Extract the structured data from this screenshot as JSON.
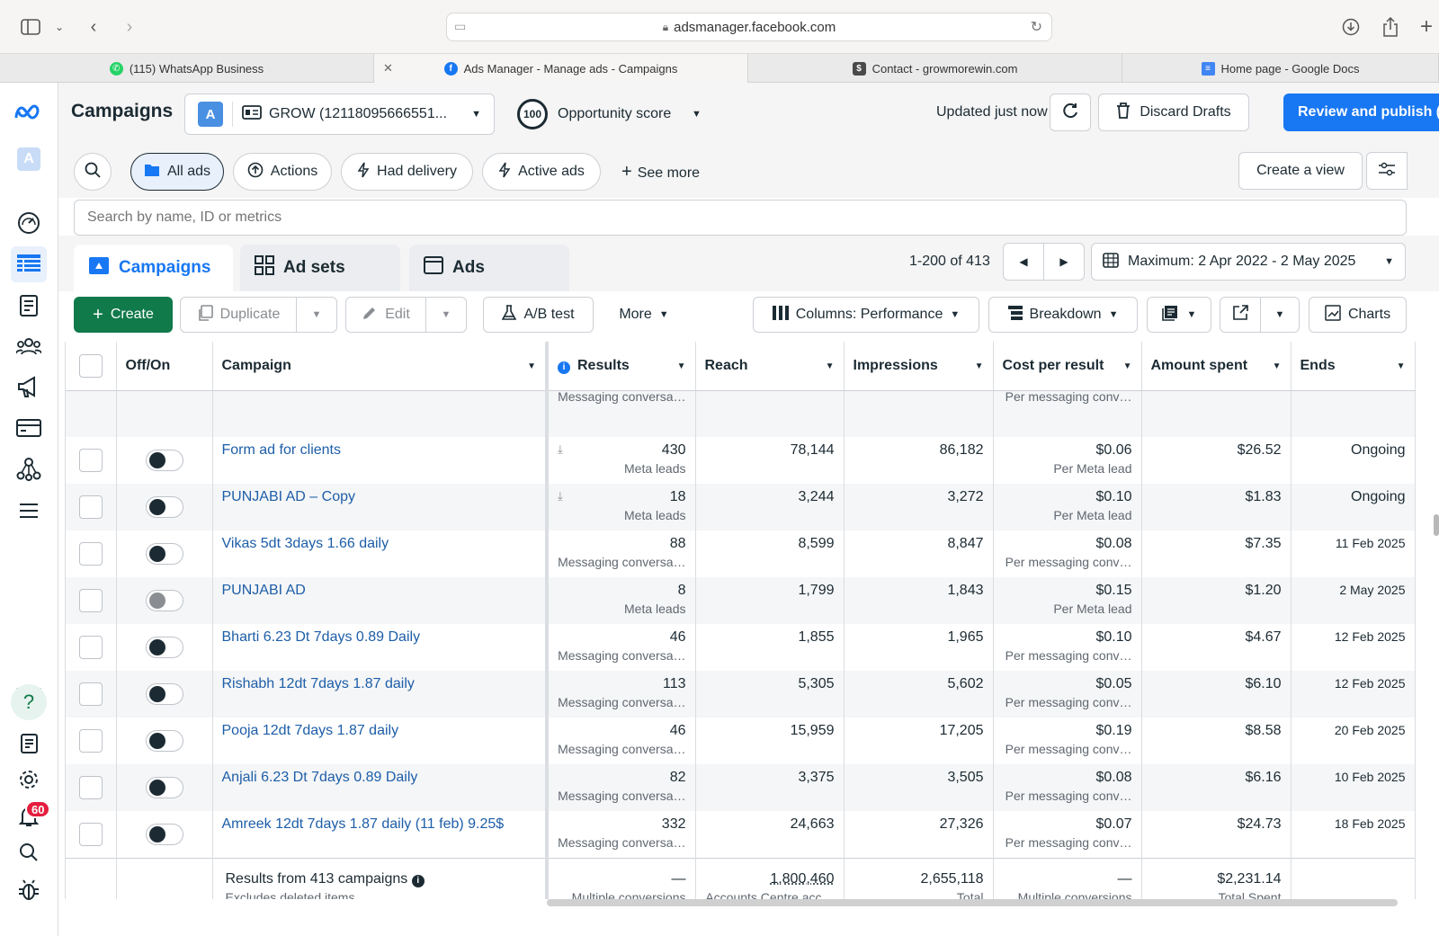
{
  "browser": {
    "url": "adsmanager.facebook.com",
    "tabs": [
      {
        "label": "(115) WhatsApp Business",
        "favicon_color": "#25d366"
      },
      {
        "label": "Ads Manager - Manage ads - Campaigns",
        "favicon_color": "#1877f2"
      },
      {
        "label": "Contact - growmorewin.com",
        "favicon_color": "#4a4a4a"
      },
      {
        "label": "Home page - Google Docs",
        "favicon_color": "#4285f4"
      }
    ]
  },
  "rail": {
    "account_letter": "A",
    "notification_count": "60"
  },
  "header": {
    "title": "Campaigns",
    "account_avatar": "A",
    "account_name": "GROW (12118095666551...",
    "opportunity_score": "100",
    "opportunity_label": "Opportunity score",
    "updated": "Updated just now",
    "discard": "Discard Drafts",
    "publish": "Review and publish ("
  },
  "filters": {
    "all_ads": "All ads",
    "actions": "Actions",
    "had_delivery": "Had delivery",
    "active_ads": "Active ads",
    "see_more": "See more",
    "create_view": "Create a view",
    "search_placeholder": "Search by name, ID or metrics"
  },
  "levels": {
    "campaigns": "Campaigns",
    "ad_sets": "Ad sets",
    "ads": "Ads",
    "pager": "1-200 of 413",
    "date_range": "Maximum: 2 Apr 2022 - 2 May 2025"
  },
  "toolbar": {
    "create": "Create",
    "duplicate": "Duplicate",
    "edit": "Edit",
    "ab_test": "A/B test",
    "more": "More",
    "columns": "Columns: Performance",
    "breakdown": "Breakdown",
    "charts": "Charts"
  },
  "table": {
    "headers": {
      "off_on": "Off/On",
      "campaign": "Campaign",
      "results": "Results",
      "reach": "Reach",
      "impressions": "Impressions",
      "cost_per_result": "Cost per result",
      "amount_spent": "Amount spent",
      "ends": "Ends"
    },
    "partial_row": {
      "results_sub": "Messaging conversa…",
      "cost_sub": "Per messaging conv…"
    },
    "rows": [
      {
        "name": "Form ad for clients",
        "on": true,
        "results": "430",
        "results_sub": "Meta leads",
        "reach": "78,144",
        "impressions": "86,182",
        "cost": "$0.06",
        "cost_sub": "Per Meta lead",
        "spent": "$26.52",
        "ends": "Ongoing"
      },
      {
        "name": "PUNJABI AD – Copy",
        "on": true,
        "results": "18",
        "results_sub": "Meta leads",
        "reach": "3,244",
        "impressions": "3,272",
        "cost": "$0.10",
        "cost_sub": "Per Meta lead",
        "spent": "$1.83",
        "ends": "Ongoing"
      },
      {
        "name": "Vikas 5dt 3days 1.66 daily",
        "on": true,
        "results": "88",
        "results_sub": "Messaging conversa…",
        "reach": "8,599",
        "impressions": "8,847",
        "cost": "$0.08",
        "cost_sub": "Per messaging conv…",
        "spent": "$7.35",
        "ends": "11 Feb 2025"
      },
      {
        "name": "PUNJABI AD",
        "on": false,
        "results": "8",
        "results_sub": "Meta leads",
        "reach": "1,799",
        "impressions": "1,843",
        "cost": "$0.15",
        "cost_sub": "Per Meta lead",
        "spent": "$1.20",
        "ends": "2 May 2025"
      },
      {
        "name": "Bharti 6.23 Dt 7days 0.89 Daily",
        "on": true,
        "results": "46",
        "results_sub": "Messaging conversa…",
        "reach": "1,855",
        "impressions": "1,965",
        "cost": "$0.10",
        "cost_sub": "Per messaging conv…",
        "spent": "$4.67",
        "ends": "12 Feb 2025"
      },
      {
        "name": "Rishabh 12dt 7days 1.87 daily",
        "on": true,
        "results": "113",
        "results_sub": "Messaging conversa…",
        "reach": "5,305",
        "impressions": "5,602",
        "cost": "$0.05",
        "cost_sub": "Per messaging conv…",
        "spent": "$6.10",
        "ends": "12 Feb 2025"
      },
      {
        "name": "Pooja 12dt 7days 1.87 daily",
        "on": true,
        "results": "46",
        "results_sub": "Messaging conversa…",
        "reach": "15,959",
        "impressions": "17,205",
        "cost": "$0.19",
        "cost_sub": "Per messaging conv…",
        "spent": "$8.58",
        "ends": "20 Feb 2025"
      },
      {
        "name": "Anjali 6.23 Dt 7days 0.89 Daily",
        "on": true,
        "results": "82",
        "results_sub": "Messaging conversa…",
        "reach": "3,375",
        "impressions": "3,505",
        "cost": "$0.08",
        "cost_sub": "Per messaging conv…",
        "spent": "$6.16",
        "ends": "10 Feb 2025"
      },
      {
        "name": "Amreek 12dt 7days 1.87 daily (11 feb) 9.25$",
        "on": true,
        "results": "332",
        "results_sub": "Messaging conversa…",
        "reach": "24,663",
        "impressions": "27,326",
        "cost": "$0.07",
        "cost_sub": "Per messaging conv…",
        "spent": "$24.73",
        "ends": "18 Feb 2025"
      }
    ],
    "footer": {
      "title": "Results from 413 campaigns",
      "subtitle": "Excludes deleted items",
      "results": "—",
      "results_sub": "Multiple conversions",
      "reach": "1,800,460",
      "reach_sub": "Accounts Centre acc…",
      "impressions": "2,655,118",
      "impressions_sub": "Total",
      "cost": "—",
      "cost_sub": "Multiple conversions",
      "spent": "$2,231.14",
      "spent_sub": "Total Spent"
    }
  },
  "colors": {
    "accent": "#1877f2",
    "create": "#107a4a",
    "link": "#1d5ea8",
    "badge": "#e41e3f"
  }
}
